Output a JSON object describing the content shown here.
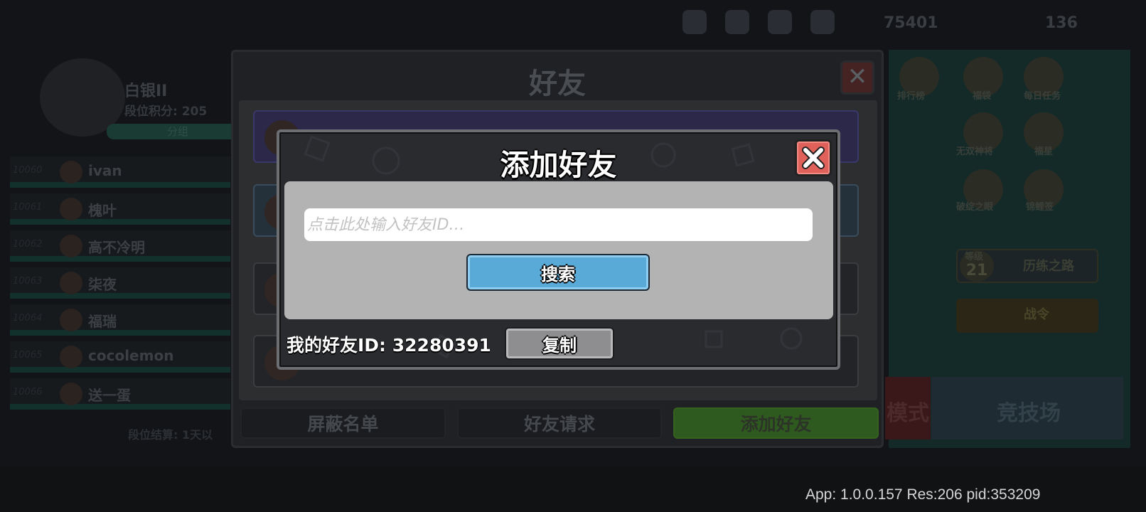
{
  "background": {
    "currency_amount": "75401",
    "currency_amount_2": "136",
    "rank": "白银II",
    "rank_points": "段位积分: 205",
    "group_label": "分组",
    "leaderboard": [
      {
        "num": "10060",
        "name": "ivan"
      },
      {
        "num": "10061",
        "name": "槐叶"
      },
      {
        "num": "10062",
        "name": "高不冷明"
      },
      {
        "num": "10063",
        "name": "柒夜"
      },
      {
        "num": "10064",
        "name": "福瑞"
      },
      {
        "num": "10065",
        "name": "cocolemon"
      },
      {
        "num": "10066",
        "name": "送一蛋"
      }
    ],
    "season_end": "段位结算: 1天以",
    "right_labels": [
      "排行榜",
      "福袋",
      "每日任务",
      "无双神将",
      "福星",
      "破绽之眼",
      "锦鲤签"
    ],
    "level_label": "等级",
    "level_value": "21",
    "trial_label": "历练之路",
    "pass_label": "战令",
    "mode_label": "模式",
    "arena_label": "竞技场"
  },
  "friends_panel": {
    "title": "好友",
    "tabs": [
      {
        "label": "屏蔽名单",
        "active": false
      },
      {
        "label": "好友请求",
        "active": false
      },
      {
        "label": "添加好友",
        "active": true
      }
    ]
  },
  "add_friend_modal": {
    "title": "添加好友",
    "search_placeholder": "点击此处输入好友ID…",
    "search_value": "",
    "search_button": "搜索",
    "my_id_label": "我的好友ID: 32280391",
    "copy_button": "复制",
    "colors": {
      "close_button": "#e0605a",
      "search_button": "#5aaad8",
      "copy_button": "#8e8e91",
      "body_panel": "#b3b3b3"
    }
  },
  "version_info": "App: 1.0.0.157 Res:206 pid:353209"
}
